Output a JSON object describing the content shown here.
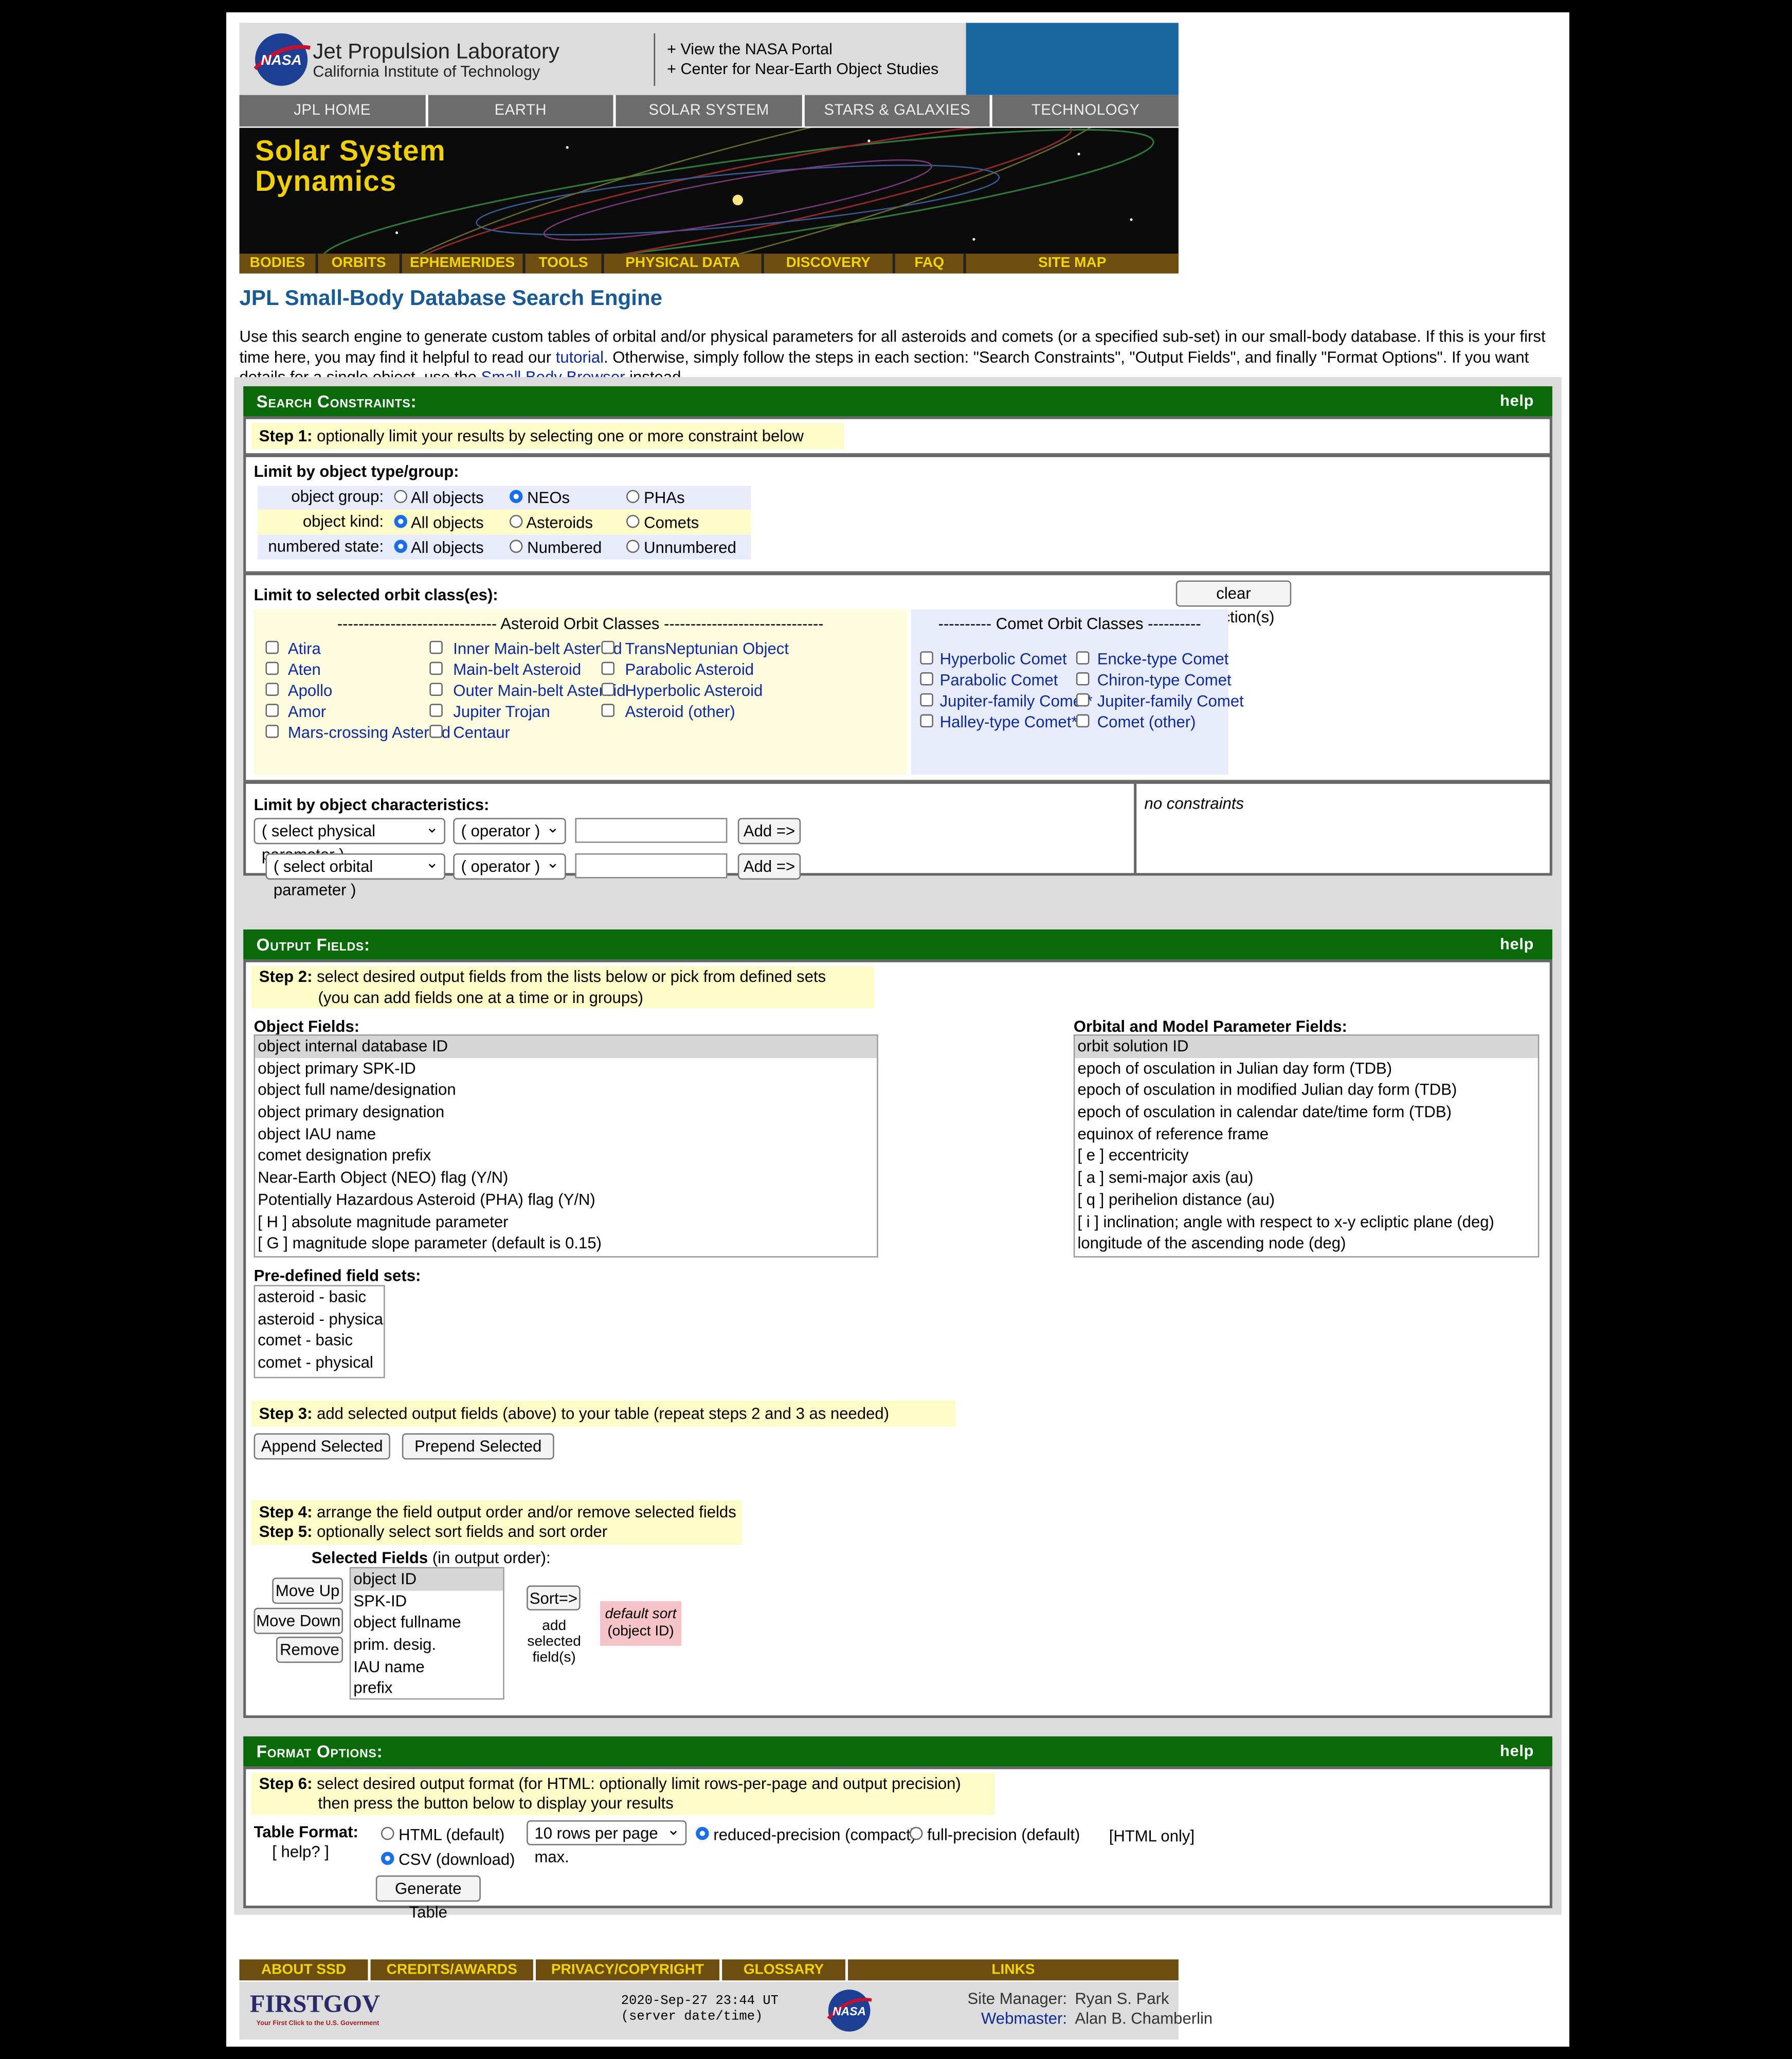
{
  "header": {
    "jpl_title": "Jet Propulsion Laboratory",
    "jpl_subtitle": "California Institute of Technology",
    "portal_link_1": "+ View the NASA Portal",
    "portal_link_2": "+ Center for Near-Earth Object Studies",
    "top_nav": [
      "JPL HOME",
      "EARTH",
      "SOLAR SYSTEM",
      "STARS & GALAXIES",
      "TECHNOLOGY"
    ],
    "banner_line_1": "Solar System",
    "banner_line_2": "Dynamics",
    "sub_nav": [
      "BODIES",
      "ORBITS",
      "EPHEMERIDES",
      "TOOLS",
      "PHYSICAL DATA",
      "DISCOVERY",
      "FAQ",
      "SITE MAP"
    ],
    "logo_text": "NASA"
  },
  "page_title": "JPL Small-Body Database Search Engine",
  "intro": {
    "text_1": "Use this search engine to generate custom tables of orbital and/or physical parameters for all asteroids and comets (or a specified sub-set) in our small-body database. If this is your first time here, you may find it helpful to read our ",
    "link_tutorial": "tutorial",
    "text_2": ". Otherwise, simply follow the steps in each section: \"Search Constraints\", \"Output Fields\", and finally \"Format Options\". If you want details for a single object, use the ",
    "link_browser": "Small Body Browser",
    "text_3": " instead."
  },
  "search": {
    "header": "Search Constraints:",
    "help": "help",
    "step1_label": "Step 1:",
    "step1_text": " optionally limit your results by selecting one or more constraint below",
    "limit_type_title": "Limit by object type/group:",
    "object_group_label": "object group:",
    "object_kind_label": "object kind:",
    "numbered_state_label": "numbered state:",
    "group_options": [
      "All objects",
      "NEOs",
      "PHAs"
    ],
    "kind_options": [
      "All objects",
      "Asteroids",
      "Comets"
    ],
    "numbered_options": [
      "All objects",
      "Numbered",
      "Unnumbered"
    ],
    "orbit_class_title": "Limit to selected orbit class(es):",
    "clear_button": "clear selection(s)",
    "asteroid_classes_header": "------------------------------ Asteroid Orbit Classes ------------------------------",
    "comet_classes_header": "---------- Comet Orbit Classes ----------",
    "asteroid_col1": [
      "Atira",
      "Aten",
      "Apollo",
      "Amor",
      "Mars-crossing Asteroid"
    ],
    "asteroid_col2": [
      "Inner Main-belt Asteroid",
      "Main-belt Asteroid",
      "Outer Main-belt Asteroid",
      "Jupiter Trojan",
      "Centaur"
    ],
    "asteroid_col3": [
      "TransNeptunian Object",
      "Parabolic Asteroid",
      "Hyperbolic Asteroid",
      "Asteroid (other)"
    ],
    "comet_col1": [
      "Hyperbolic Comet",
      "Parabolic Comet",
      "Jupiter-family Comet*",
      "Halley-type Comet*"
    ],
    "comet_col2": [
      "Encke-type Comet",
      "Chiron-type Comet",
      "Jupiter-family Comet",
      "Comet (other)"
    ],
    "characteristics_title": "Limit by object characteristics:",
    "physical_select": "( select physical parameter )",
    "orbital_select": "( select orbital parameter )",
    "operator_select": "( operator )",
    "add_button": "Add =>",
    "no_constraints": "no constraints"
  },
  "output": {
    "header": "Output Fields:",
    "help": "help",
    "step2_label": "Step 2:",
    "step2_text_1": " select desired output fields from the lists below or pick from defined sets",
    "step2_text_2": "(you can add fields one at a time or in groups)",
    "object_fields_title": "Object Fields:",
    "object_fields": [
      "object internal database ID",
      "object primary SPK-ID",
      "object full name/designation",
      "object primary designation",
      "object IAU name",
      "comet designation prefix",
      "Near-Earth Object (NEO) flag (Y/N)",
      "Potentially Hazardous Asteroid (PHA) flag (Y/N)",
      "[ H ] absolute magnitude parameter",
      "[ G ] magnitude slope parameter (default is 0.15)"
    ],
    "orbital_fields_title": "Orbital and Model Parameter Fields:",
    "orbital_fields": [
      "orbit solution ID",
      "epoch of osculation in Julian day form (TDB)",
      "epoch of osculation in modified Julian day form (TDB)",
      "epoch of osculation in calendar date/time form (TDB)",
      "equinox of reference frame",
      "[ e ] eccentricity",
      "[ a ] semi-major axis (au)",
      "[ q ] perihelion distance (au)",
      "[ i ] inclination; angle with respect to x-y ecliptic plane (deg)",
      "longitude of the ascending node (deg)"
    ],
    "predefined_title": "Pre-defined field sets:",
    "predefined_sets": [
      "asteroid - basic",
      "asteroid - physical",
      "comet - basic",
      "comet - physical"
    ],
    "step3_label": "Step 3:",
    "step3_text": " add selected output fields (above) to your table (repeat steps 2 and 3 as needed)",
    "append_button": "Append Selected",
    "prepend_button": "Prepend Selected",
    "step4_label": "Step 4:",
    "step4_text": " arrange the field output order and/or remove selected fields",
    "step5_label": "Step 5:",
    "step5_text": " optionally select sort fields and sort order",
    "selected_fields_title": "Selected Fields",
    "selected_fields_note": " (in output order):",
    "move_up_button": "Move Up",
    "move_down_button": "Move Down",
    "remove_button": "Remove",
    "selected_fields": [
      "object ID",
      "SPK-ID",
      "object fullname",
      "prim. desig.",
      "IAU name",
      "prefix"
    ],
    "sort_button": "Sort=>",
    "sort_note_1": "add",
    "sort_note_2": "selected",
    "sort_note_3": "field(s)",
    "default_sort_1": "default sort",
    "default_sort_2": "(object ID)"
  },
  "format": {
    "header": "Format Options:",
    "help": "help",
    "step6_label": "Step 6:",
    "step6_text_1": " select desired output format (for HTML: optionally limit rows-per-page and output precision)",
    "step6_text_2": "then press the button below to display your results",
    "table_format_label": "Table Format:",
    "table_format_help": "[ help? ]",
    "html_option": "HTML (default)",
    "csv_option": "CSV (download)",
    "rows_select": "10 rows per page max.",
    "reduced_option": "reduced-precision (compact)",
    "full_option": "full-precision (default)",
    "html_only_note": "[HTML only]",
    "generate_button": "Generate Table"
  },
  "footer": {
    "nav": [
      "ABOUT SSD",
      "CREDITS/AWARDS",
      "PRIVACY/COPYRIGHT",
      "GLOSSARY",
      "LINKS"
    ],
    "firstgov": "FIRSTGOV",
    "firstgov_tagline": "Your First Click to the U.S. Government",
    "server_time": "2020-Sep-27 23:44 UT",
    "server_time_note": "(server date/time)",
    "site_manager_label": "Site Manager:",
    "site_manager_name": "Ryan S. Park",
    "webmaster_label": "Webmaster:",
    "webmaster_name": "Alan B. Chamberlin"
  }
}
